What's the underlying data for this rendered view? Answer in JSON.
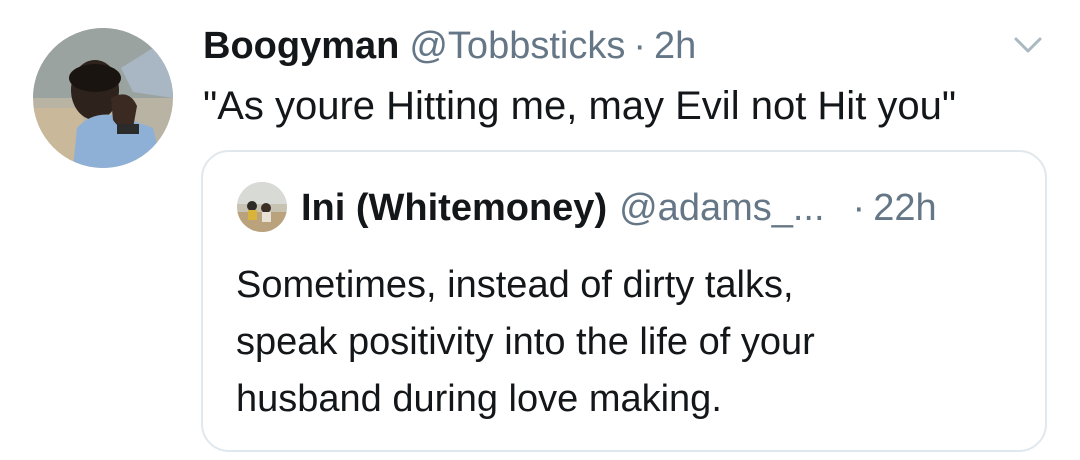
{
  "tweet": {
    "display_name": "Boogyman",
    "handle": "@Tobbsticks",
    "separator": "·",
    "time": "2h",
    "text": "\"As youre Hitting me, may Evil not Hit you\"",
    "avatar_icon": "user-avatar-photo",
    "menu_icon": "chevron-down-icon"
  },
  "quote": {
    "display_name": "Ini (Whitemoney)",
    "handle": "@adams_...",
    "separator": "·",
    "time": "22h",
    "text_lines": [
      "Sometimes, instead of dirty talks,",
      "speak positivity into the life of your",
      "husband during love making."
    ],
    "avatar_icon": "quoted-user-avatar-photo"
  },
  "colors": {
    "primary_text": "#14171a",
    "secondary_text": "#657786",
    "border": "#e1e8ed",
    "background": "#ffffff"
  }
}
